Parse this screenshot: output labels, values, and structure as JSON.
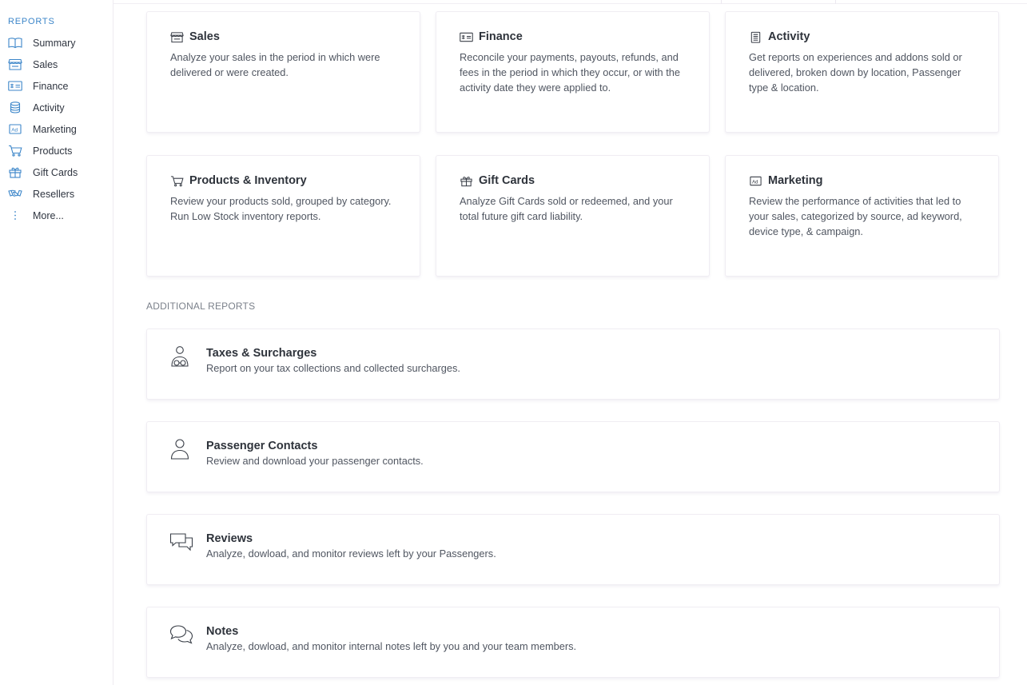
{
  "sidebar": {
    "heading": "REPORTS",
    "items": [
      {
        "label": "Summary",
        "icon": "book-icon"
      },
      {
        "label": "Sales",
        "icon": "store-icon"
      },
      {
        "label": "Finance",
        "icon": "cheque-icon"
      },
      {
        "label": "Activity",
        "icon": "database-icon"
      },
      {
        "label": "Marketing",
        "icon": "ad-icon"
      },
      {
        "label": "Products",
        "icon": "cart-icon"
      },
      {
        "label": "Gift Cards",
        "icon": "gift-icon"
      },
      {
        "label": "Resellers",
        "icon": "handshake-icon"
      },
      {
        "label": "More...",
        "icon": "more-vertical-icon"
      }
    ]
  },
  "cards": [
    {
      "title": "Sales",
      "icon": "store-icon",
      "description": "Analyze your sales in the period in which were delivered or were created."
    },
    {
      "title": "Finance",
      "icon": "cheque-icon",
      "description": "Reconcile your payments, payouts, refunds, and fees in the period in which they occur, or with the activity date they were applied to."
    },
    {
      "title": "Activity",
      "icon": "clipboard-list-icon",
      "description": "Get reports on experiences and addons sold or delivered, broken down by location, Passenger type & location."
    },
    {
      "title": "Products & Inventory",
      "icon": "cart-icon",
      "description": "Review your products sold, grouped by category. Run Low Stock inventory reports."
    },
    {
      "title": "Gift Cards",
      "icon": "gift-icon",
      "description": "Analyze Gift Cards sold or redeemed, and your total future gift card liability."
    },
    {
      "title": "Marketing",
      "icon": "ad-icon",
      "description": "Review the performance of activities that led to your sales, categorized by source, ad keyword, device type, & campaign."
    }
  ],
  "additional": {
    "heading": "ADDITIONAL REPORTS",
    "items": [
      {
        "title": "Taxes & Surcharges",
        "icon": "accountant-icon",
        "description": "Report on your tax collections and collected surcharges."
      },
      {
        "title": "Passenger Contacts",
        "icon": "user-icon",
        "description": "Review and download your passenger contacts."
      },
      {
        "title": "Reviews",
        "icon": "chat-bubbles-icon",
        "description": "Analyze, dowload, and monitor reviews left by your Passengers."
      },
      {
        "title": "Notes",
        "icon": "comments-icon",
        "description": "Analyze, dowload, and monitor internal notes left by you and your team members."
      }
    ]
  },
  "colors": {
    "accent": "#3c86c9",
    "text": "#2e333b",
    "muted": "#505661"
  }
}
